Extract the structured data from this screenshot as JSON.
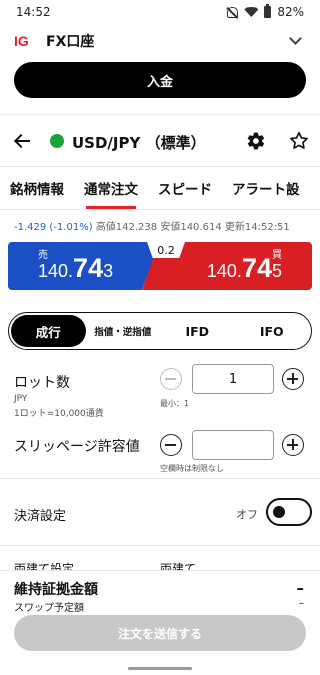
{
  "status_bar": {
    "time": "14:52",
    "battery": "82%"
  },
  "header": {
    "logo": "IG",
    "account_title": "FX口座",
    "deposit_label": "入金"
  },
  "instrument": {
    "name": "USD/JPY （標準）",
    "status_color": "#19a33a"
  },
  "tabs": [
    {
      "label": "銘柄情報",
      "active": false
    },
    {
      "label": "通常注文",
      "active": true
    },
    {
      "label": "スピード",
      "active": false
    },
    {
      "label": "アラート設",
      "active": false
    }
  ],
  "stats": {
    "change": "-1.429 (-1.01%)",
    "high": "高値142.238",
    "low": "安値140.614",
    "updated": "更新14:52:51"
  },
  "prices": {
    "sell_label": "売",
    "sell_main": "140.",
    "sell_big": "74",
    "sell_pip": "3",
    "buy_label": "買",
    "buy_main": "140.",
    "buy_big": "74",
    "buy_pip": "5",
    "spread": "0.2",
    "sell_color": "#1b4fc6",
    "buy_color": "#d71f24"
  },
  "order_types": [
    {
      "label": "成行",
      "active": true
    },
    {
      "label": "指値・逆指値",
      "active": false
    },
    {
      "label": "IFD",
      "active": false
    },
    {
      "label": "IFO",
      "active": false
    }
  ],
  "lot": {
    "label": "ロット数",
    "unit": "JPY",
    "unit_note": "1ロット=10,000通貨",
    "value": "1",
    "hint": "最小：1"
  },
  "slippage": {
    "label": "スリッページ許容値",
    "value": "",
    "hint": "空欄時は制限なし"
  },
  "settlement": {
    "label": "決済設定",
    "state": "オフ"
  },
  "partial_row": {
    "left": "両建て設定",
    "right": "両建て"
  },
  "margin": {
    "label": "維持証拠金額",
    "value": "–",
    "swap_label": "スワップ予定額",
    "swap_value": "–"
  },
  "submit_label": "注文を送信する"
}
